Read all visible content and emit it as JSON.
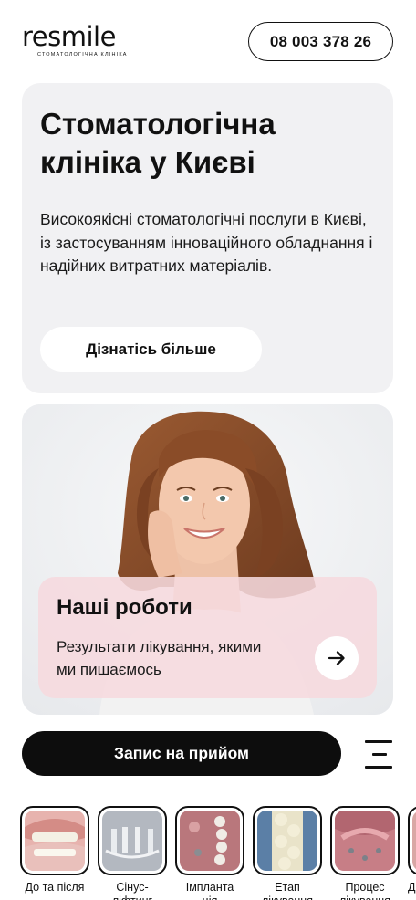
{
  "header": {
    "logo_word": "resmile",
    "logo_sub": "СТОМАТОЛОГІЧНА КЛІНІКА",
    "phone": "08 003 378 26"
  },
  "hero": {
    "title": "Стоматологічна клініка у Києві",
    "text": "Високоякісні стоматологічні послуги в Києві, із застосуванням інноваційного обладнання і надійних витратних матеріалів.",
    "button": "Дізнатісь більше"
  },
  "works": {
    "title": "Наші роботи",
    "text": "Результати лікування, якими ми пишаємось",
    "arrow_icon": "arrow-right-icon"
  },
  "appointment": {
    "button": "Запис на прийом",
    "menu_icon": "menu-icon"
  },
  "stories": [
    {
      "label": "До та після",
      "label2": ""
    },
    {
      "label": "Сінус-",
      "label2": "ліфтинг"
    },
    {
      "label": "Імпланта",
      "label2": "ція"
    },
    {
      "label": "Етап",
      "label2": "лікування"
    },
    {
      "label": "Процес",
      "label2": "лікування"
    },
    {
      "label": "Д",
      "label2": ""
    }
  ],
  "colors": {
    "primary": "#0d0d0d",
    "hero_bg": "#f1f1f3",
    "works_panel": "#f6dade",
    "white": "#ffffff"
  }
}
